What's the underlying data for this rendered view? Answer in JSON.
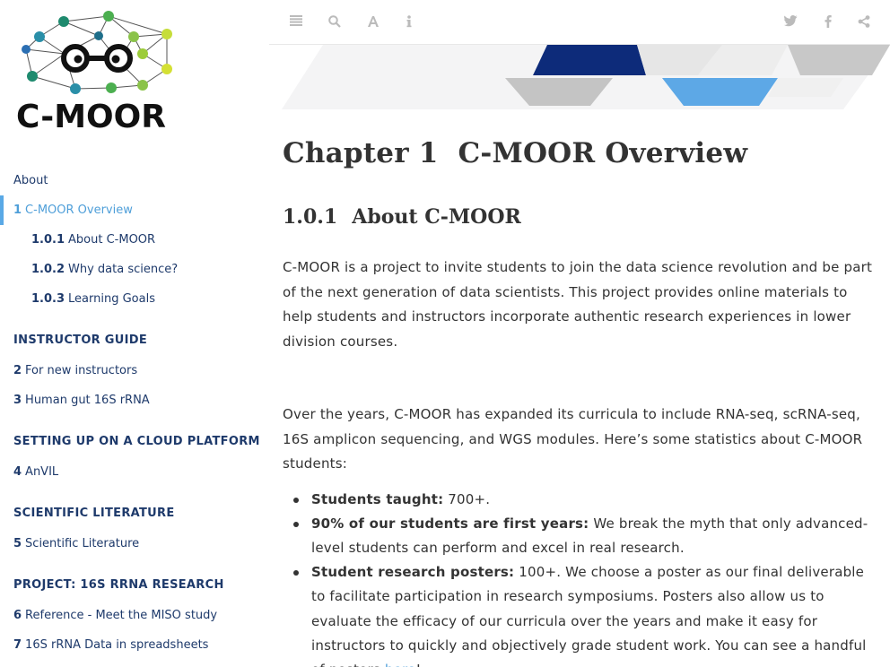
{
  "logo": {
    "text": "C-MOOR"
  },
  "toolbar": {
    "left_icons": [
      "menu-icon",
      "search-icon",
      "font-icon",
      "info-icon"
    ],
    "right_icons": [
      "twitter-icon",
      "facebook-icon",
      "share-icon"
    ]
  },
  "sidebar": {
    "items": [
      {
        "type": "item",
        "num": "",
        "label": "About",
        "level": 1,
        "active": false
      },
      {
        "type": "item",
        "num": "1",
        "label": "C-MOOR Overview",
        "level": 1,
        "active": true
      },
      {
        "type": "item",
        "num": "1.0.1",
        "label": "About C-MOOR",
        "level": 2,
        "active": false
      },
      {
        "type": "item",
        "num": "1.0.2",
        "label": "Why data science?",
        "level": 2,
        "active": false
      },
      {
        "type": "item",
        "num": "1.0.3",
        "label": "Learning Goals",
        "level": 2,
        "active": false
      },
      {
        "type": "header",
        "label": "INSTRUCTOR GUIDE"
      },
      {
        "type": "item",
        "num": "2",
        "label": "For new instructors",
        "level": 1,
        "active": false
      },
      {
        "type": "item",
        "num": "3",
        "label": "Human gut 16S rRNA",
        "level": 1,
        "active": false
      },
      {
        "type": "header",
        "label": "SETTING UP ON A CLOUD PLATFORM"
      },
      {
        "type": "item",
        "num": "4",
        "label": "AnVIL",
        "level": 1,
        "active": false
      },
      {
        "type": "header",
        "label": "SCIENTIFIC LITERATURE"
      },
      {
        "type": "item",
        "num": "5",
        "label": "Scientific Literature",
        "level": 1,
        "active": false
      },
      {
        "type": "header",
        "label": "PROJECT: 16S RRNA RESEARCH"
      },
      {
        "type": "item",
        "num": "6",
        "label": "Reference - Meet the MISO study",
        "level": 1,
        "active": false
      },
      {
        "type": "item",
        "num": "7",
        "label": "16S rRNA Data in spreadsheets",
        "level": 1,
        "active": false
      }
    ]
  },
  "content": {
    "chapter_num": "Chapter 1",
    "chapter_title": "C-MOOR Overview",
    "section_num": "1.0.1",
    "section_title": "About C-MOOR",
    "para1": "C-MOOR is a project to invite students to join the data science revolution and be part of the next generation of data scientists. This project provides online materials to help students and instructors incorporate authentic research experiences in lower division courses.",
    "para2": "Over the years, C-MOOR has expanded its curricula to include RNA-seq, scRNA-seq, 16S amplicon sequencing, and WGS modules. Here’s some statistics about C-MOOR students:",
    "stats": [
      {
        "bold": "Students taught:",
        "text": " 700+.",
        "link": "",
        "after": ""
      },
      {
        "bold": "90% of our students are first years:",
        "text": " We break the myth that only advanced-level students can perform and excel in real research.",
        "link": "",
        "after": ""
      },
      {
        "bold": "Student research posters:",
        "text": " 100+. We choose a poster as our final deliverable to facilitate participation in research symposiums. Posters also allow us to evaluate the efficacy of our curricula over the years and make it easy for instructors to quickly and objectively grade student work. You can see a handful of posters ",
        "link": "here",
        "after": "!"
      }
    ]
  }
}
